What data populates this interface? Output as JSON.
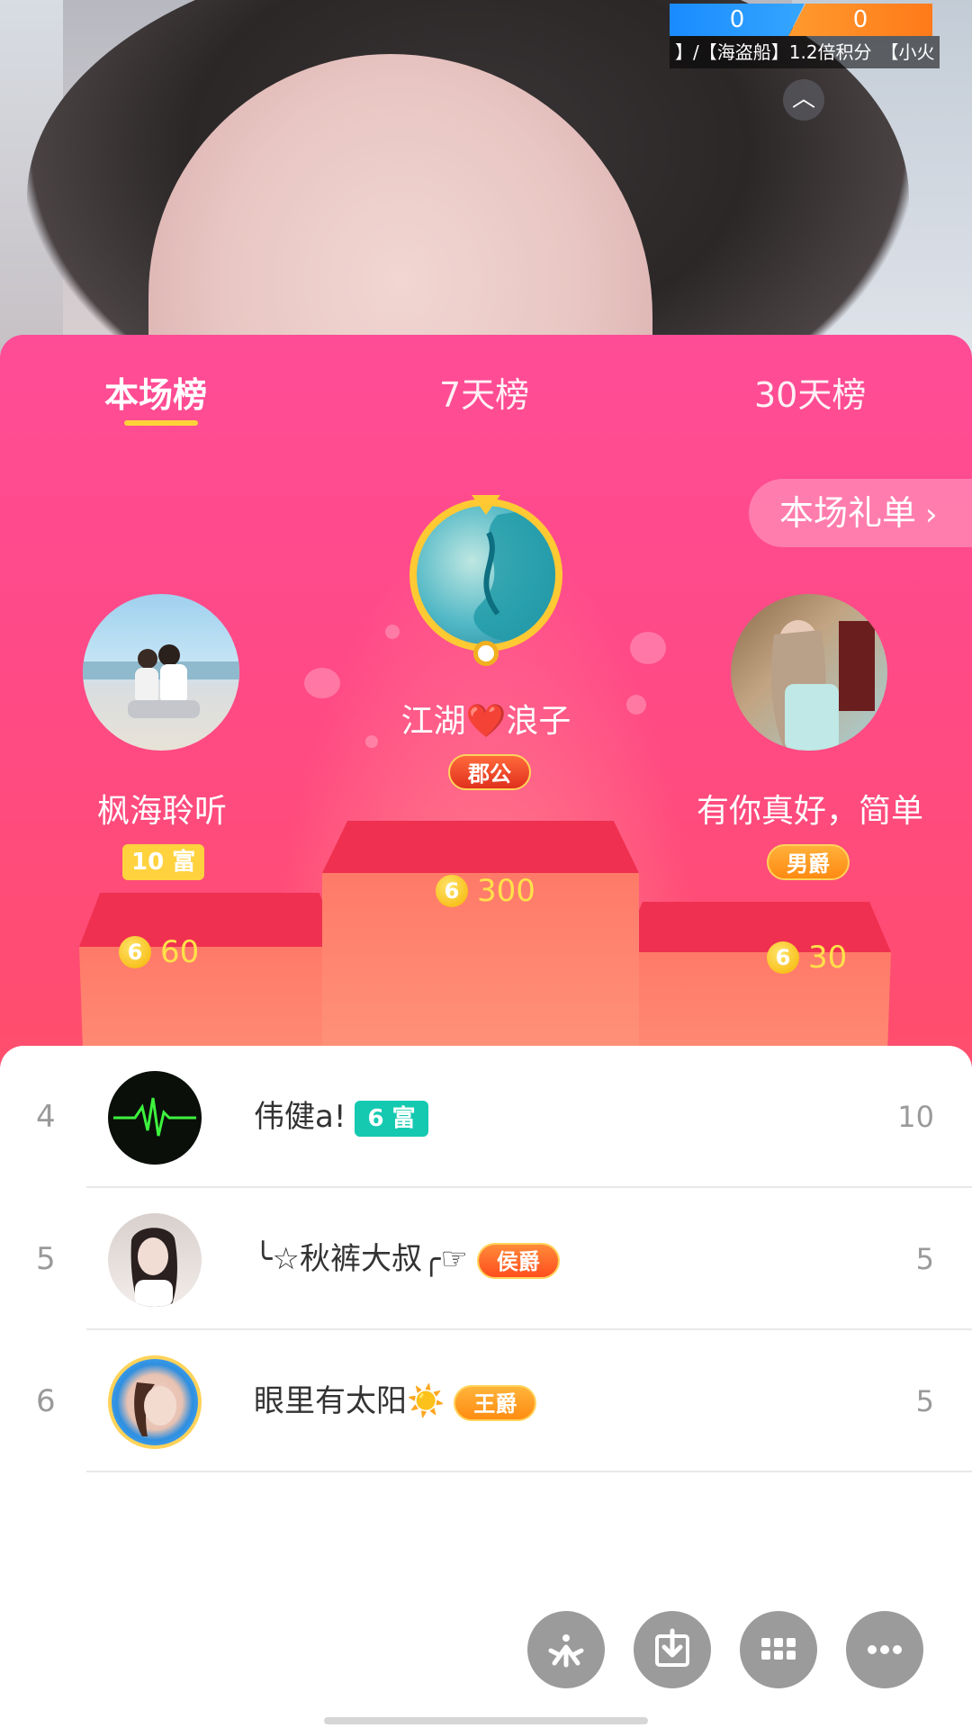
{
  "stream": {
    "pk_left_score": "0",
    "pk_right_score": "0",
    "ticker_text": "】/【海盗船】1.2倍积分　【小火"
  },
  "tabs": [
    {
      "label": "本场榜",
      "active": true
    },
    {
      "label": "7天榜",
      "active": false
    },
    {
      "label": "30天榜",
      "active": false
    }
  ],
  "gift_list_button": "本场礼单",
  "podium": {
    "first": {
      "rank": "1",
      "name": "江湖❤️浪子",
      "title_badge": "郡公",
      "score": "300",
      "coin": "6"
    },
    "second": {
      "rank": "2",
      "name": "枫海聆听",
      "level_badge": "10 富",
      "score": "60",
      "coin": "6"
    },
    "third": {
      "rank": "3",
      "name": "有你真好，简单",
      "title_badge": "男爵",
      "score": "30",
      "coin": "6"
    }
  },
  "list": [
    {
      "rank": "4",
      "name": "伟健a!",
      "badge": "6 富",
      "badge_type": "fu",
      "score": "10"
    },
    {
      "rank": "5",
      "name": "╰☆秋裤大叔╭☞",
      "badge": "侯爵",
      "badge_type": "title",
      "score": "5"
    },
    {
      "rank": "6",
      "name": "眼里有太阳☀️",
      "badge": "王爵",
      "badge_type": "king",
      "score": "5"
    }
  ],
  "colors": {
    "panel_pink": "#ff4c96",
    "gold_text": "#ffe14a",
    "tab_underline": "#ffd23a",
    "fu_badge_teal": "#15c9b1"
  },
  "tool_icons": [
    "share-icon",
    "download-icon",
    "grid-icon",
    "more-icon"
  ]
}
